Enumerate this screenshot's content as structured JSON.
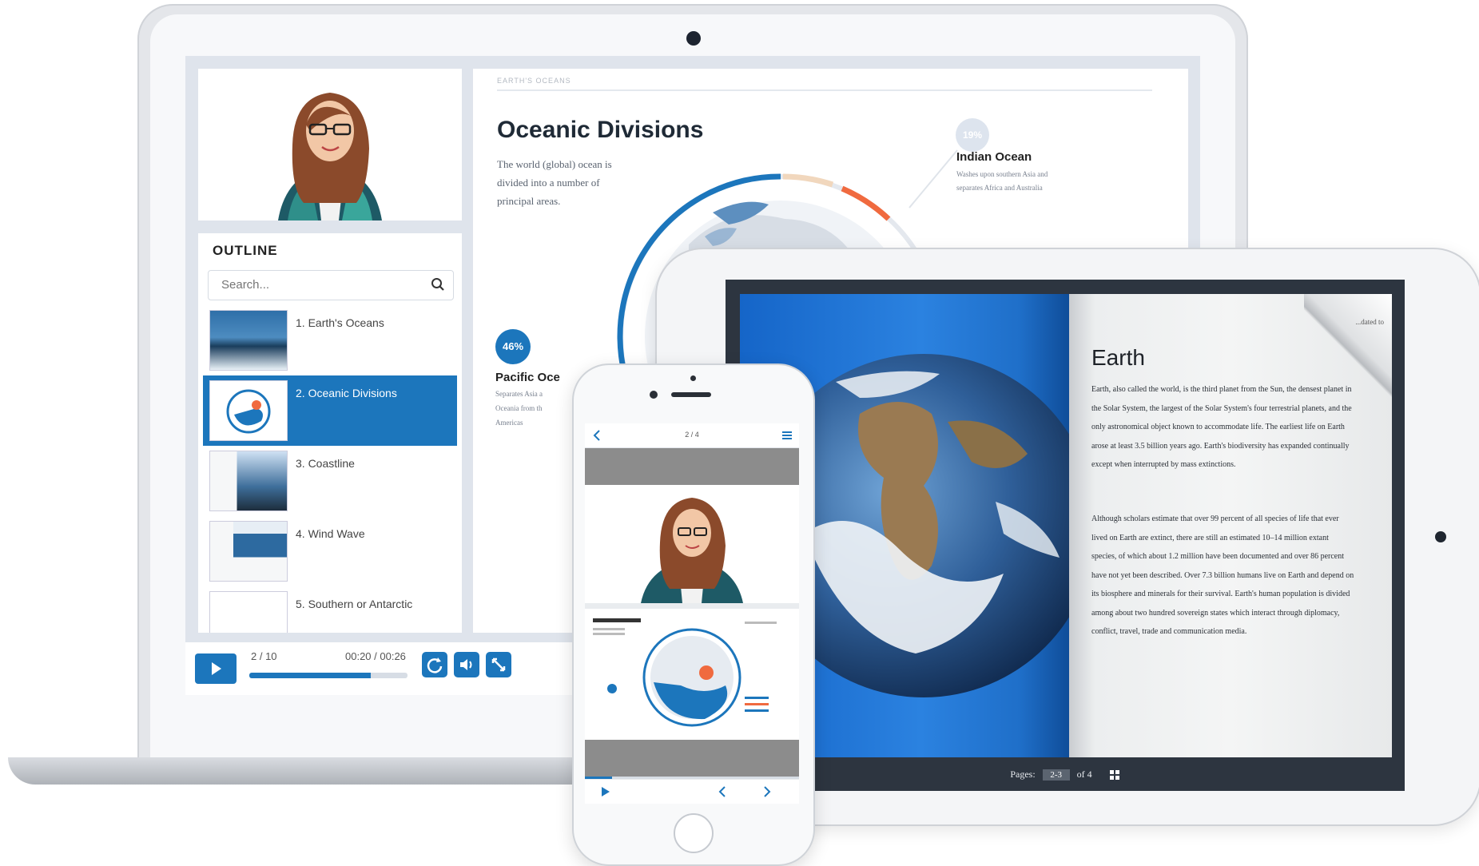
{
  "laptop": {
    "outline": {
      "title": "OUTLINE",
      "search_placeholder": "Search...",
      "items": [
        {
          "label": "1. Earth's Oceans"
        },
        {
          "label": "2. Oceanic Divisions",
          "active": true
        },
        {
          "label": "3. Coastline"
        },
        {
          "label": "4. Wind Wave"
        },
        {
          "label": "5. Southern or Antarctic"
        }
      ]
    },
    "slide": {
      "breadcrumb": "EARTH'S OCEANS",
      "title": "Oceanic Divisions",
      "body": "The world (global) ocean is divided into a number of principal areas.",
      "indian_ocean": {
        "title": "Indian Ocean",
        "desc": "Washes upon southern Asia and separates Africa and Australia",
        "percent": "19%"
      },
      "pacific": {
        "title": "Pacific Oce",
        "desc": "Separates Asia a Oceania from th Americas",
        "percent": "46%"
      }
    },
    "player": {
      "slide_counter": "2 / 10",
      "time": "00:20 / 00:26",
      "progress": 0.77
    }
  },
  "tablet": {
    "book": {
      "title": "Earth",
      "para1": "Earth, also called the world, is the third planet from the Sun, the densest planet in the Solar System, the largest of the Solar System's four terrestrial planets, and the only astronomical object known to accommodate life. The earliest life on Earth arose at least 3.5 billion years ago. Earth's biodiversity has expanded continually except when interrupted by mass extinctions.",
      "para2": "Although scholars estimate that over 99 percent of all species of life that ever lived on Earth are extinct, there are still an estimated 10–14 million extant species, of which about 1.2 million have been documented and over 86 percent have not yet been described. Over 7.3 billion humans live on Earth and depend on its biosphere and minerals for their survival. Earth's human population is divided among about two hundred sovereign states which interact through diplomacy, conflict, travel, trade and communication media.",
      "curl_text": "...dated to",
      "footer_pages_label": "Pages:",
      "footer_page_value": "2-3",
      "footer_of": "of 4"
    }
  },
  "phone": {
    "counter": "2 / 4"
  },
  "colors": {
    "accent_blue": "#1c76bc",
    "accent_orange": "#f06a3f",
    "beige": "#f1d7bd"
  }
}
